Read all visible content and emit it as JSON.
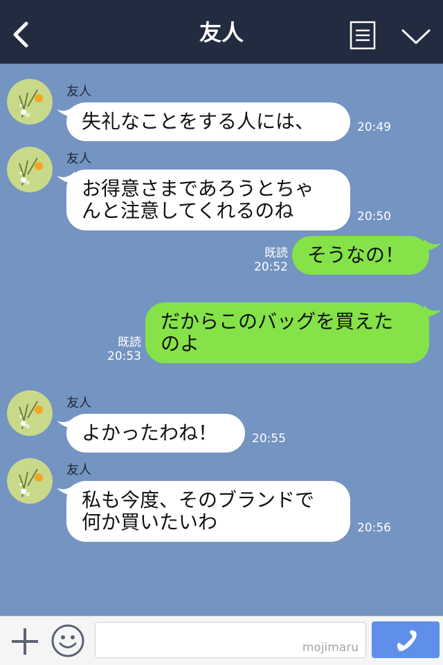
{
  "header": {
    "title": "友人",
    "back_icon": "chevron-left-icon",
    "menu_icon": "list-icon",
    "collapse_icon": "chevron-down-icon"
  },
  "messages": [
    {
      "sender": "友人",
      "text": "失礼なことをする人には、",
      "time": "20:49",
      "direction": "in"
    },
    {
      "sender": "友人",
      "text": "お得意さまであろうとちゃ\nんと注意してくれるのね",
      "time": "20:50",
      "direction": "in"
    },
    {
      "read": "既読",
      "text": "そうなの！",
      "time": "20:52",
      "direction": "out"
    },
    {
      "read": "既読",
      "text": "だからこのバッグを買えた\nのよ",
      "time": "20:53",
      "direction": "out"
    },
    {
      "sender": "友人",
      "text": "よかったわね！",
      "time": "20:55",
      "direction": "in"
    },
    {
      "sender": "友人",
      "text": "私も今度、そのブランドで\n何か買いたいわ",
      "time": "20:56",
      "direction": "in"
    }
  ],
  "input": {
    "placeholder": "",
    "watermark": "mojimaru"
  },
  "colors": {
    "header_bg": "#232b40",
    "chat_bg": "#7494c1",
    "incoming_bubble": "#ffffff",
    "outgoing_bubble": "#85e249",
    "call_button": "#5f8fea"
  },
  "icons": {
    "plus": "plus-icon",
    "emoji": "smiley-icon",
    "call": "phone-icon"
  }
}
